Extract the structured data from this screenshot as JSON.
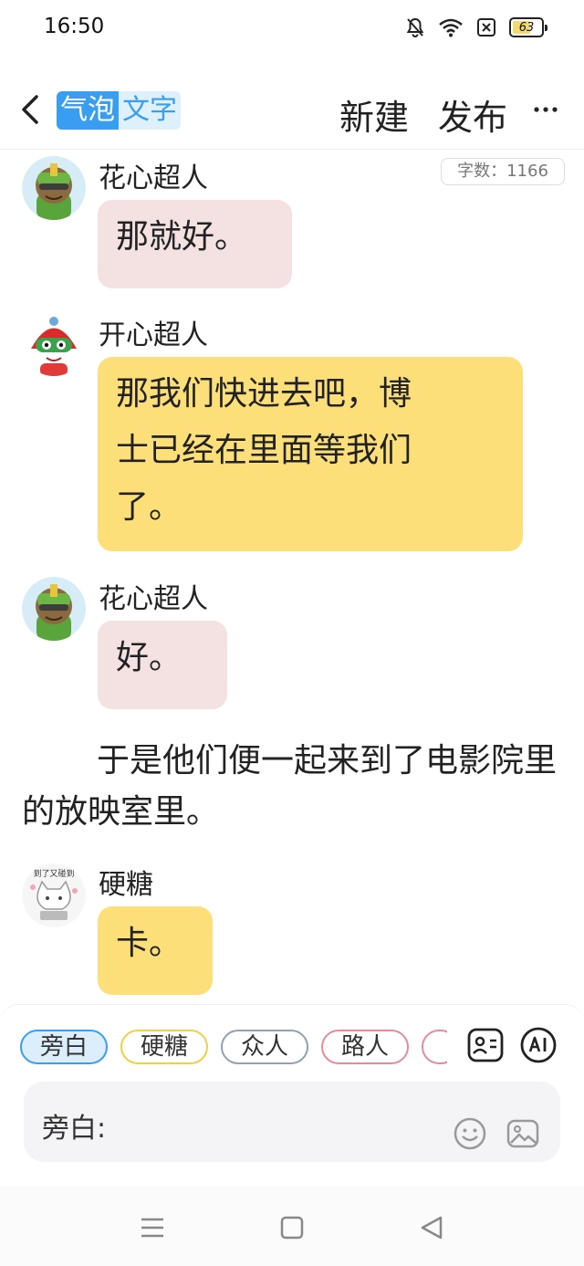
{
  "status_bar": {
    "time": "16:50",
    "battery": "63",
    "battery_level": 0.63
  },
  "header": {
    "back_icon": "chevron-left-icon",
    "logo_part1": "气泡",
    "logo_part2": "文字",
    "new_label": "新建",
    "publish_label": "发布",
    "more_icon": "more-horizontal-icon"
  },
  "word_count": "字数：1166",
  "messages": [
    {
      "name": "花心超人",
      "text": "那就好。",
      "color": "#f4e1e2"
    },
    {
      "name": "开心超人",
      "text_lines": [
        "那我们快进去吧，博",
        "士已经在里面等我们",
        "了。"
      ],
      "color": "#fddf7a"
    },
    {
      "name": "花心超人",
      "text": "好。",
      "color": "#f4e1e2"
    },
    {
      "name": "硬糖",
      "text": "卡。",
      "color": "#fddf7a",
      "avatar_text": "到了又碰到"
    }
  ],
  "narration": "于是他们便一起来到了电影院里的放映室里。",
  "composer": {
    "roles": [
      "旁白",
      "硬糖",
      "众人",
      "路人"
    ],
    "input_label": "旁白:"
  },
  "colors": {
    "accent": "#3a9ef0",
    "pink_bubble": "#f4e1e2",
    "yellow_bubble": "#fddf7a"
  }
}
